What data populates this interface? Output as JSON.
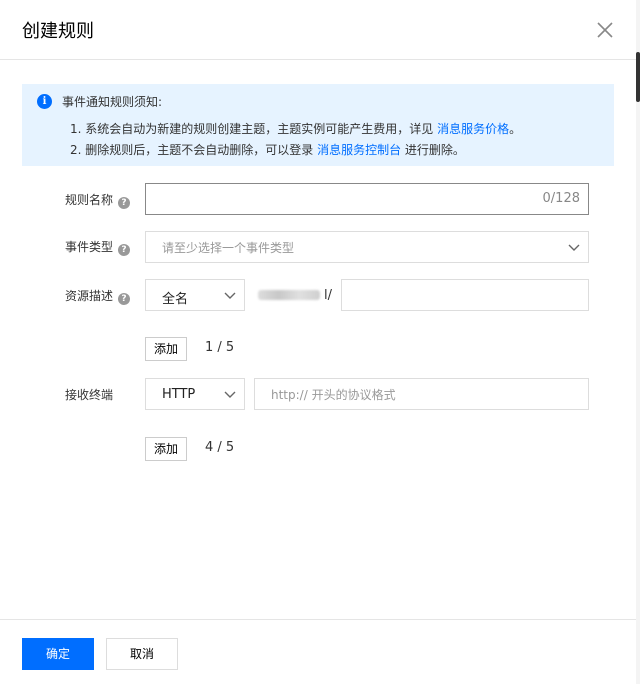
{
  "dialog": {
    "title": "创建规则"
  },
  "notice": {
    "title": "事件通知规则须知:",
    "line1_text": "1. 系统会自动为新建的规则创建主题，主题实例可能产生费用，详见 ",
    "line1_link": "消息服务价格",
    "line1_end": "。",
    "line2_text": "2. 删除规则后，主题不会自动删除，可以登录 ",
    "line2_link": "消息服务控制台",
    "line2_end": " 进行删除。"
  },
  "form": {
    "rule_name": {
      "label": "规则名称",
      "value": "",
      "counter": "0/128"
    },
    "event_type": {
      "label": "事件类型",
      "placeholder": "请至少选择一个事件类型"
    },
    "resource": {
      "label": "资源描述",
      "match_mode": "全名",
      "slash": "l/",
      "value": "",
      "add_label": "添加",
      "count": "1 / 5"
    },
    "endpoint": {
      "label": "接收终端",
      "protocol": "HTTP",
      "placeholder": "http:// 开头的协议格式",
      "add_label": "添加",
      "count": "4 / 5"
    }
  },
  "footer": {
    "confirm_label": "确定",
    "cancel_label": "取消"
  },
  "colors": {
    "primary": "#006eff",
    "notice_bg": "#e6f3ff"
  }
}
